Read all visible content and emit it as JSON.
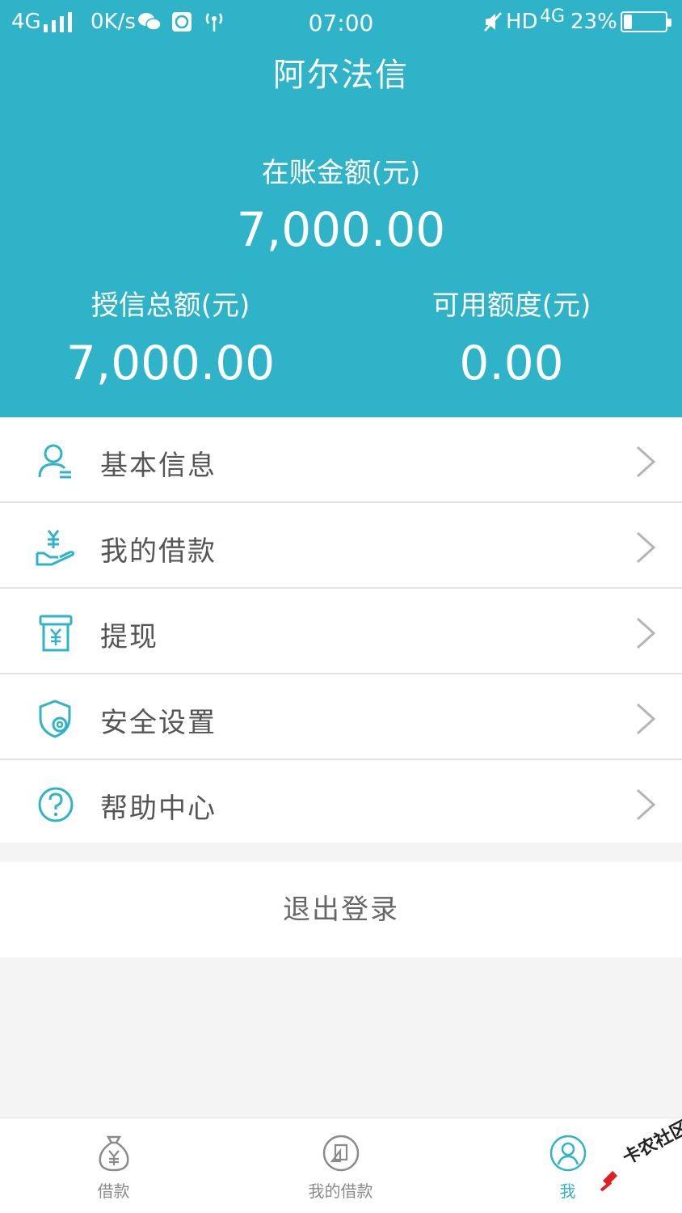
{
  "status_bar": {
    "network": "4G",
    "speed": "0K/s",
    "time": "07:00",
    "hd": "HD",
    "net_type": "4G",
    "battery": "23%"
  },
  "header": {
    "title": "阿尔法信",
    "balance_label": "在账金额(元)",
    "balance_value": "7,000.00",
    "credit_total_label": "授信总额(元)",
    "credit_total_value": "7,000.00",
    "available_label": "可用额度(元)",
    "available_value": "0.00"
  },
  "menu": [
    {
      "label": "基本信息",
      "icon": "user-info-icon"
    },
    {
      "label": "我的借款",
      "icon": "loan-hand-icon"
    },
    {
      "label": "提现",
      "icon": "withdraw-icon"
    },
    {
      "label": "安全设置",
      "icon": "security-shield-icon"
    },
    {
      "label": "帮助中心",
      "icon": "help-icon"
    }
  ],
  "logout_label": "退出登录",
  "tabbar": [
    {
      "label": "借款",
      "icon": "money-bag-icon",
      "active": false
    },
    {
      "label": "我的借款",
      "icon": "document-icon",
      "active": false
    },
    {
      "label": "我",
      "icon": "profile-icon",
      "active": true
    }
  ],
  "watermark": "卡农社区",
  "colors": {
    "primary": "#2fb3c9",
    "background": "#f4f4f4",
    "text": "#555555"
  }
}
